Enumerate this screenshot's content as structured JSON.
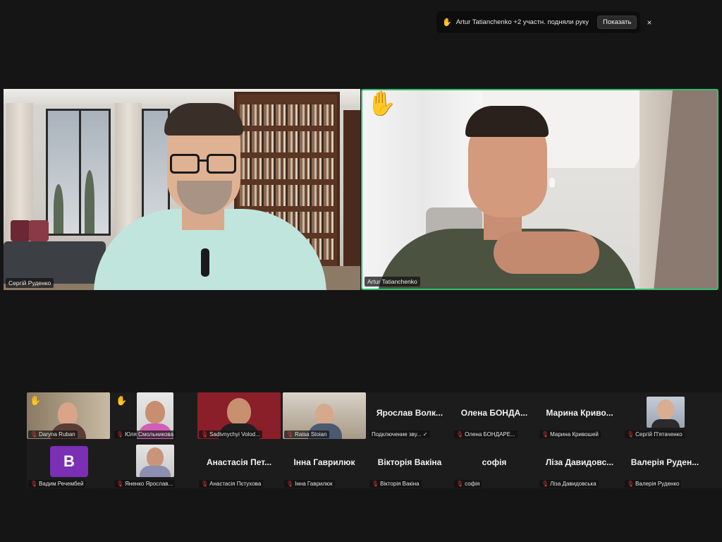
{
  "notification": {
    "icon": "raised-hand-icon",
    "text": "Artur Tatianchenko +2 участн. подняли руку",
    "button": "Показать",
    "close": "×"
  },
  "main_tiles": [
    {
      "name": "Сергій Руденко",
      "raised_hand": false,
      "active_speaker": false
    },
    {
      "name": "Artur Tatianchenko",
      "raised_hand": true,
      "active_speaker": true
    }
  ],
  "raised_hand_glyph": "✋",
  "muted_glyph": "🎙",
  "participants_row1": [
    {
      "label": "Daryna Ruban",
      "video": true,
      "hand": true,
      "muted": true
    },
    {
      "label": "Юля Смольникова",
      "video": true,
      "hand": true,
      "muted": true
    },
    {
      "label": "Sadivnychyi Volod...",
      "video": true,
      "hand": false,
      "muted": true
    },
    {
      "label": "Raisa Stoian",
      "video": true,
      "hand": false,
      "muted": true
    },
    {
      "display": "Ярослав Волк...",
      "label": "Подключение зву...",
      "video": false,
      "muted": false
    },
    {
      "display": "Олена БОНДА...",
      "label": "Олена БОНДАРЕ...",
      "video": false,
      "muted": true
    },
    {
      "display": "Марина Криво...",
      "label": "Марина Кривошей",
      "video": false,
      "muted": true
    },
    {
      "label": "Сергій П'ятаченко",
      "video": true,
      "hand": false,
      "muted": true
    }
  ],
  "participants_row2": [
    {
      "label": "Вадим Речембей",
      "avatar_letter": "B",
      "avatar_color": "#7a2fb5",
      "muted": true
    },
    {
      "label": "Яненко Ярослав...",
      "video": true,
      "muted": true
    },
    {
      "display": "Анастасія Пет...",
      "label": "Анастасія Пєтухова",
      "muted": true
    },
    {
      "display": "Інна Гаврилюк",
      "label": "Інна Гаврилюк",
      "muted": true
    },
    {
      "display": "Вікторія Вакіна",
      "label": "Вікторія Вакіна",
      "muted": true
    },
    {
      "display": "софія",
      "label": "софія",
      "muted": true
    },
    {
      "display": "Ліза Давидовс...",
      "label": "Ліза Давидовська",
      "muted": true
    },
    {
      "display": "Валерія Руден...",
      "label": "Валерія Руденко",
      "muted": true
    }
  ],
  "colors": {
    "active_border": "#2fbf71",
    "muted": "#e53935",
    "background": "#151515"
  }
}
